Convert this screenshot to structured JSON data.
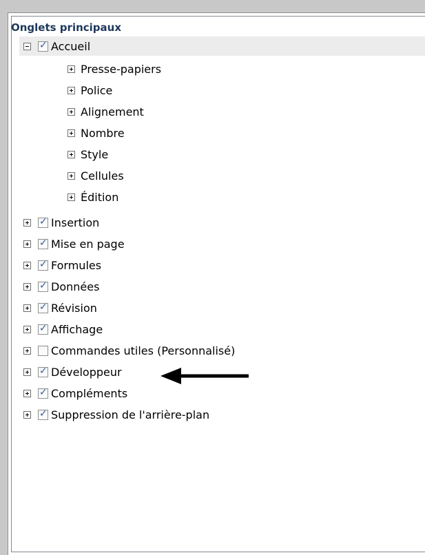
{
  "header": {
    "title": "Onglets principaux"
  },
  "tree": {
    "accueil": {
      "label": "Accueil",
      "checked": true,
      "expanded": true,
      "children": [
        {
          "label": "Presse-papiers"
        },
        {
          "label": "Police"
        },
        {
          "label": "Alignement"
        },
        {
          "label": "Nombre"
        },
        {
          "label": "Style"
        },
        {
          "label": "Cellules"
        },
        {
          "label": "Édition"
        }
      ]
    },
    "items": [
      {
        "label": "Insertion",
        "checked": true
      },
      {
        "label": "Mise en page",
        "checked": true
      },
      {
        "label": "Formules",
        "checked": true
      },
      {
        "label": "Données",
        "checked": true
      },
      {
        "label": "Révision",
        "checked": true
      },
      {
        "label": "Affichage",
        "checked": true
      },
      {
        "label": "Commandes utiles (Personnalisé)",
        "checked": false
      },
      {
        "label": "Développeur",
        "checked": true
      },
      {
        "label": "Compléments",
        "checked": true
      },
      {
        "label": "Suppression de l'arrière-plan",
        "checked": true
      }
    ]
  },
  "colors": {
    "header_text": "#1e395b",
    "check_mark": "#2f5f9d",
    "selected_row": "#ececec",
    "arrow": "#000000"
  },
  "icons": {
    "expander_collapsed": "plus-box-icon",
    "expander_expanded": "minus-box-icon",
    "annotation": "left-arrow-icon"
  }
}
